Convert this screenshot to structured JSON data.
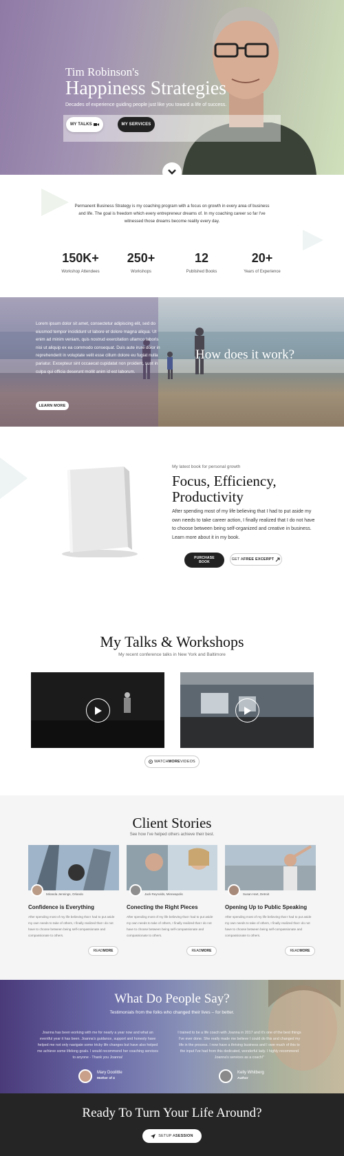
{
  "hero": {
    "name": "Tim Robinson's",
    "title": "Happiness Strategies",
    "subtitle": "Decades of experience guiding people just like you toward a life of success.",
    "btn_talks": "MY TALKS",
    "btn_services": "MY SERVICES"
  },
  "intro": {
    "text": "Permanent Business Strategy is my coaching program with a focus on growth in every area of business and life. The goal is freedom which every entrepreneur dreams of. In my coaching career so far I've witnessed those dreams become reality every day.",
    "stats": [
      {
        "value": "150K+",
        "label": "Workshop Attendees"
      },
      {
        "value": "250+",
        "label": "Workshops"
      },
      {
        "value": "12",
        "label": "Published Books"
      },
      {
        "value": "20+",
        "label": "Years of Experience"
      }
    ]
  },
  "how": {
    "text": "Lorem ipsum dolor sit amet, consectetur adipiscing elit, sed do eiusmod tempor incididunt ut labore et dolore magna aliqua. Ut enim ad minim veniam, quis nostrud exercitation ullamco laboris nisi ut aliquip ex ea commodo consequat. Duis aute irure dolor in reprehenderit in voluptate velit esse cillum dolore eu fugiat nulla pariatur. Excepteur sint occaecat cupidatat non proident, sunt in culpa qui officia deserunt mollit anim id est laborum.",
    "title": "How does it work?",
    "btn": "LEARN MORE"
  },
  "book": {
    "tag": "My latest book for personal growth",
    "title_line1": "Focus, Efficiency,",
    "title_line2": "Productivity",
    "desc": "After spending most of my life believing that I had to put aside my own needs to take career action, I finally realized that I do not have to choose between being self-organized and creative in business. Learn more about it in my book.",
    "btn_purchase_1": "PURCHASE",
    "btn_purchase_2": "BOOK",
    "btn_excerpt_a": "GET A ",
    "btn_excerpt_b": "FREE EXCERPT"
  },
  "talks": {
    "title": "My Talks & Workshops",
    "subtitle": "My recent conference talks in New York and Baltimore",
    "btn_a": "WATCH ",
    "btn_b": "MORE",
    "btn_c": " VIDEOS"
  },
  "clients": {
    "title": "Client Stories",
    "subtitle": "See how I've helped others achieve their best.",
    "cards": [
      {
        "author": "Miranda Jennings, Orlando",
        "title": "Confidence is Everything",
        "desc": "After spending most of my life believing that I had to put aside my own needs to take of others, I finally realized that I do not have to choose between being self-compassionate and compassionate to others.",
        "btn_a": "READ ",
        "btn_b": "MORE"
      },
      {
        "author": "Jack Reynolds, Minneapolis",
        "title": "Conecting the Right Pieces",
        "desc": "After spending most of my life believing that I had to put aside my own needs to take of others, I finally realized that I do not have to choose between being self-compassionate and compassionate to others.",
        "btn_a": "READ ",
        "btn_b": "MORE"
      },
      {
        "author": "Susan Hart, Detroit",
        "title": "Opening Up to Public Speaking",
        "desc": "After spending most of my life believing that I had to put aside my own needs to take of others, I finally realized that I do not have to choose between being self-compassionate and compassionate to others.",
        "btn_a": "READ ",
        "btn_b": "MORE"
      }
    ]
  },
  "testimonials": {
    "title": "What Do People Say?",
    "subtitle": "Testimonials from the folks who changed their lives – for better.",
    "items": [
      {
        "quote": "Joanna has been working with me for nearly a year now and what an eventful year it has been. Joanna's guidance, support and honesty have helped me not only navigate some tricky life changes but have also helped me achieve some lifelong goals. I would recommend her coaching services to anyone - Thank you Joanna!",
        "name": "Mary Doolittle",
        "role": "Mother of 4"
      },
      {
        "quote": "I trained to be a life coach with Joanna in 2017 and it's one of the best things I've ever done. She really made me believe I could do this and changed my life in the process. I now have a thriving business and I owe much of this to the input I've had from this dedicated, wonderful lady. I highly recommend Joanna's services as a coach!\"",
        "name": "Kelly Whitberg",
        "role": "Author"
      }
    ]
  },
  "cta": {
    "title": "Ready To Turn Your Life Around?",
    "btn_a": "SETUP A ",
    "btn_b": "SESSION"
  },
  "colors": {
    "dark": "#222222",
    "footer_bg": "#252525",
    "section_gray": "#f5f5f5"
  }
}
